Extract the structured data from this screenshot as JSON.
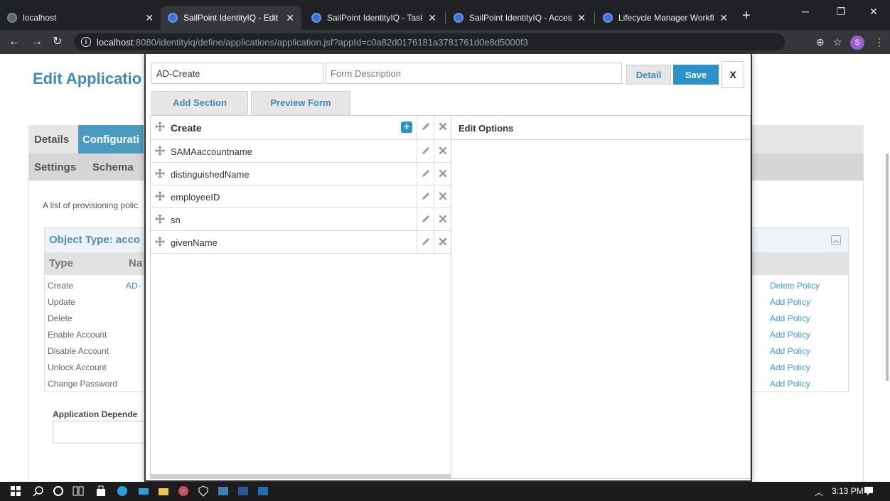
{
  "browser": {
    "tabs": [
      {
        "title": "localhost",
        "active": false
      },
      {
        "title": "SailPoint IdentityIQ - Edit A",
        "active": true
      },
      {
        "title": "SailPoint IdentityIQ - Tasks",
        "active": false
      },
      {
        "title": "SailPoint IdentityIQ - Acces",
        "active": false
      },
      {
        "title": "Lifecycle Manager Workflo",
        "active": false
      }
    ],
    "url_host": "localhost",
    "url_rest": ":8080/identityiq/define/applications/application.jsf?appId=c0a82d0176181a3781761d0e8d5000f3",
    "profile_initial": "S"
  },
  "page": {
    "title": "Edit Applicatio",
    "tabs": {
      "details": "Details",
      "configuration": "Configurati"
    },
    "subtabs": {
      "settings": "Settings",
      "schema": "Schema"
    },
    "provisioning_description": "A list of provisioning polic",
    "object_type_title": "Object Type: acco",
    "columns": {
      "type": "Type",
      "name": "Na"
    },
    "policies": [
      {
        "type": "Create",
        "name": "AD-",
        "action": "Delete Policy"
      },
      {
        "type": "Update",
        "name": "",
        "action": "Add Policy"
      },
      {
        "type": "Delete",
        "name": "",
        "action": "Add Policy"
      },
      {
        "type": "Enable Account",
        "name": "",
        "action": "Add Policy"
      },
      {
        "type": "Disable Account",
        "name": "",
        "action": "Add Policy"
      },
      {
        "type": "Unlock Account",
        "name": "",
        "action": "Add Policy"
      },
      {
        "type": "Change Password",
        "name": "",
        "action": "Add Policy"
      }
    ],
    "app_dependencies_title": "Application Depende"
  },
  "form_editor": {
    "form_name": "AD-Create",
    "form_description_placeholder": "Form Description",
    "detail_label": "Detail",
    "save_label": "Save",
    "close_label": "X",
    "add_section_label": "Add Section",
    "preview_form_label": "Preview Form",
    "section_name": "Create",
    "fields": [
      "SAMAaccountname",
      "distinguishedName",
      "employeeID",
      "sn",
      "givenName"
    ],
    "edit_options_title": "Edit Options"
  },
  "taskbar": {
    "clock": "3:13 PM"
  }
}
